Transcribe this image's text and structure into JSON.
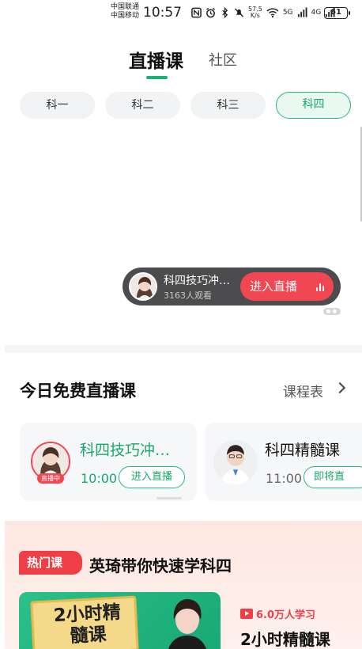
{
  "status_bar": {
    "carrier_1": "中国联通",
    "carrier_2": "中国移动",
    "time": "10:57",
    "speed_value": "57.5",
    "speed_unit": "K/s",
    "signal_1": "5G",
    "signal_2": "4G",
    "battery": "61",
    "icons": [
      "nfc-icon",
      "alarm-icon",
      "bluetooth-icon",
      "mute-icon",
      "wifi-icon",
      "signal-icon"
    ]
  },
  "top_tabs": {
    "active": "直播课",
    "other": "社区"
  },
  "subjects": [
    {
      "label": "科一",
      "active": false
    },
    {
      "label": "科二",
      "active": false
    },
    {
      "label": "科三",
      "active": false
    },
    {
      "label": "科四",
      "active": true
    }
  ],
  "live_bar": {
    "title": "科四技巧冲…",
    "viewers": "3163人观看",
    "button": "进入直播"
  },
  "today": {
    "title": "今日免费直播课",
    "schedule_link": "课程表",
    "cards": [
      {
        "title": "科四技巧冲…",
        "time": "10:00",
        "button": "进入直播",
        "live_tag": "直播中"
      },
      {
        "title": "科四精髓课",
        "time": "11:00",
        "button": "即将直"
      }
    ]
  },
  "hot_course": {
    "tag": "热门课",
    "title": "英琦带你快速学科四",
    "banner_text": "2小时精髓课",
    "learners": "6.0万人学习",
    "course_name": "2小时精髓课"
  },
  "colors": {
    "accent_green": "#1bb375",
    "live_red": "#f04753",
    "hot_red": "#ef3e45"
  }
}
